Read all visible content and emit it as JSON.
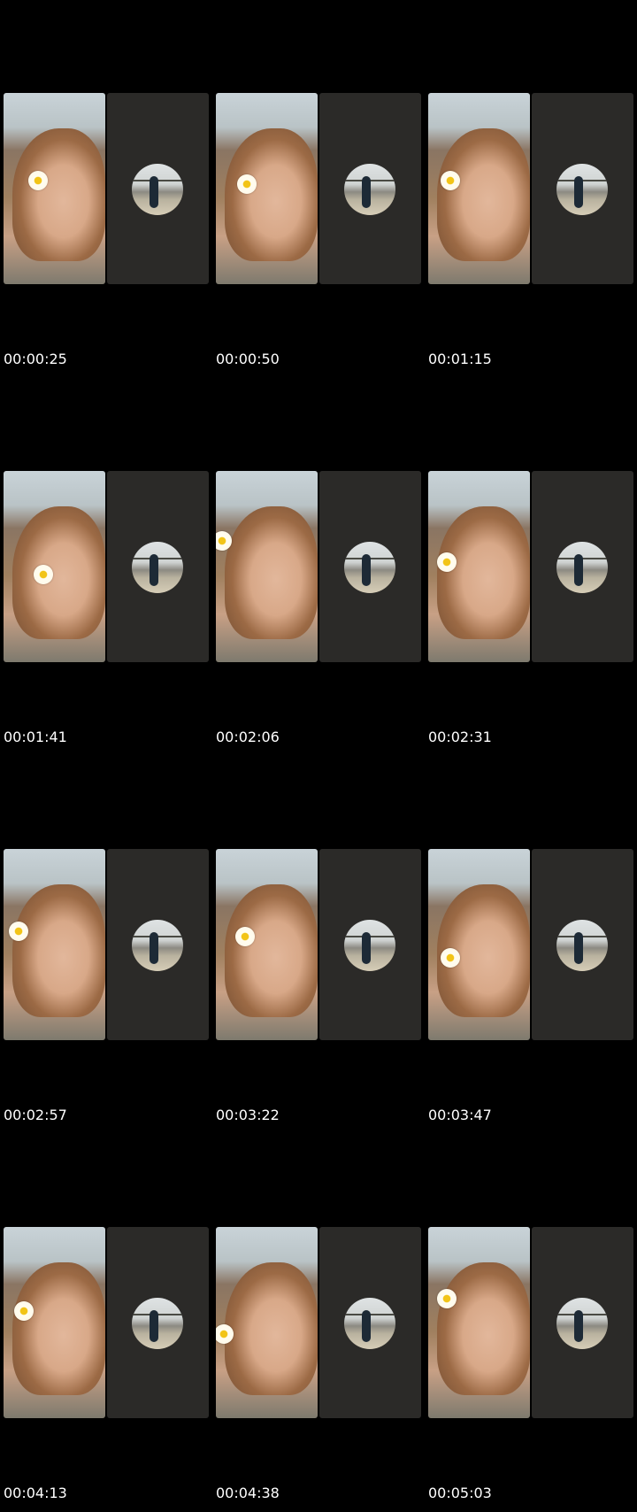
{
  "frames": [
    {
      "timestamp": "00:00:25"
    },
    {
      "timestamp": "00:00:50"
    },
    {
      "timestamp": "00:01:15"
    },
    {
      "timestamp": "00:01:41"
    },
    {
      "timestamp": "00:02:06"
    },
    {
      "timestamp": "00:02:31"
    },
    {
      "timestamp": "00:02:57"
    },
    {
      "timestamp": "00:03:22"
    },
    {
      "timestamp": "00:03:47"
    },
    {
      "timestamp": "00:04:13"
    },
    {
      "timestamp": "00:04:38"
    },
    {
      "timestamp": "00:05:03"
    }
  ],
  "colors": {
    "background": "#000000",
    "right_pane": "#2b2a28",
    "timestamp_text": "#ffffff"
  }
}
